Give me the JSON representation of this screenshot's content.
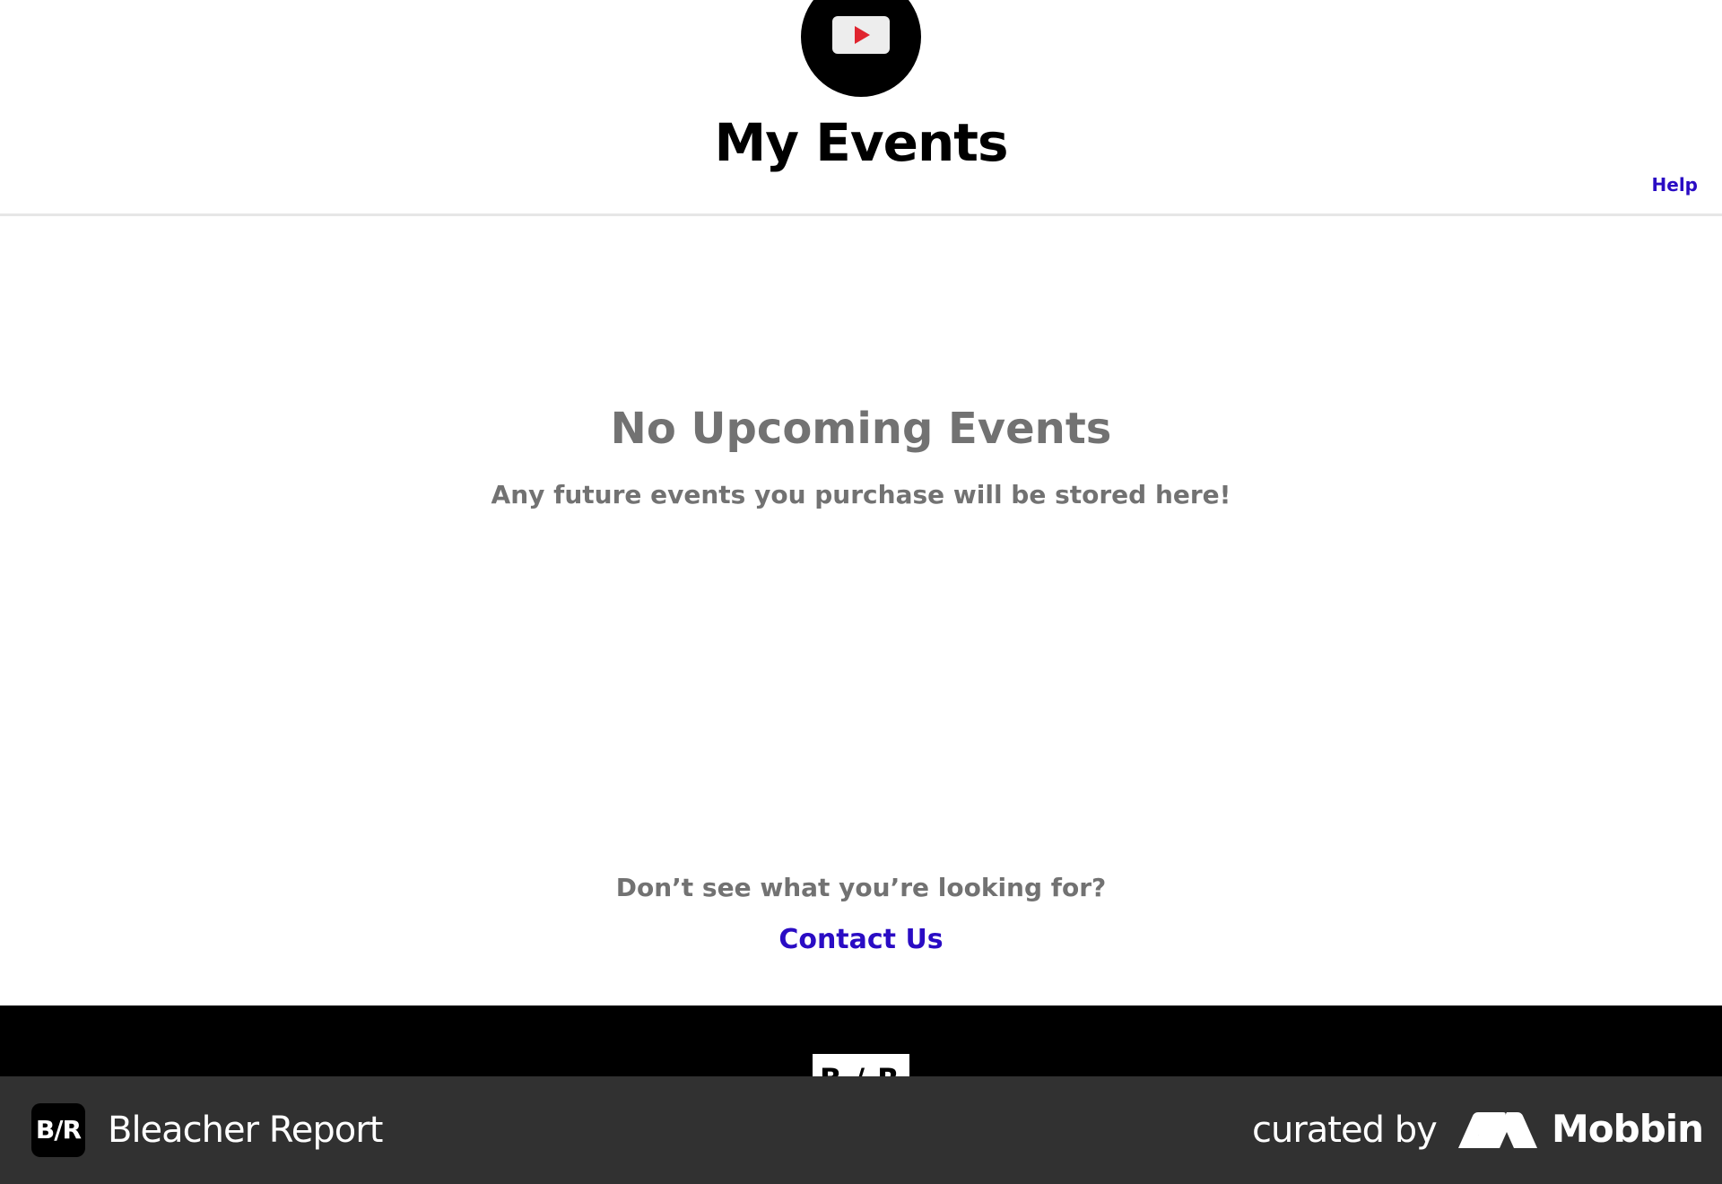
{
  "header": {
    "title": "My Events",
    "help_label": "Help",
    "logo_icon": "video-play-icon"
  },
  "empty_state": {
    "title": "No Upcoming Events",
    "subtitle": "Any future events you purchase will be stored here!"
  },
  "contact": {
    "prompt": "Don’t see what you’re looking for?",
    "link_label": "Contact Us"
  },
  "footer": {
    "logo_text": "B/R"
  },
  "attribution": {
    "app_badge_text": "B/R",
    "app_name": "Bleacher Report",
    "curated_by": "curated by",
    "brand": "Mobbin"
  },
  "colors": {
    "link": "#2a0cc4",
    "muted_text": "#727272",
    "play_red": "#e0242f",
    "attribution_bg": "#313131"
  }
}
